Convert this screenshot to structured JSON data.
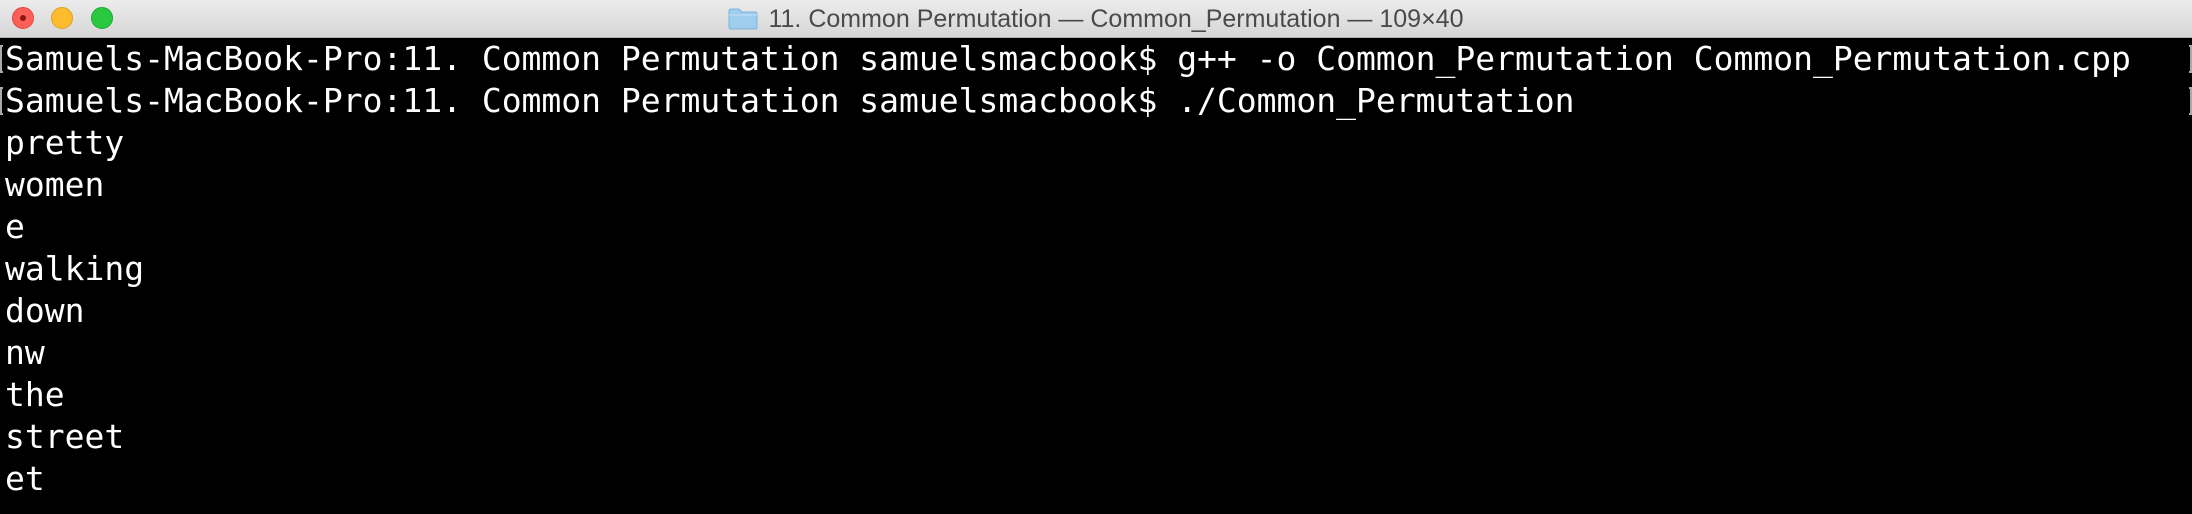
{
  "window": {
    "title": "11. Common Permutation — Common_Permutation — 109×40",
    "folder_icon": "folder-icon",
    "colors": {
      "background": "#000000",
      "text": "#ffffff",
      "close": "#fc5f57",
      "minimize": "#fdbb2e",
      "zoom": "#29c840"
    }
  },
  "terminal": {
    "lines": [
      "Samuels-MacBook-Pro:11. Common Permutation samuelsmacbook$ g++ -o Common_Permutation Common_Permutation.cpp",
      "Samuels-MacBook-Pro:11. Common Permutation samuelsmacbook$ ./Common_Permutation",
      "pretty",
      "women",
      "e",
      "walking",
      "down",
      "nw",
      "the",
      "street",
      "et"
    ]
  }
}
